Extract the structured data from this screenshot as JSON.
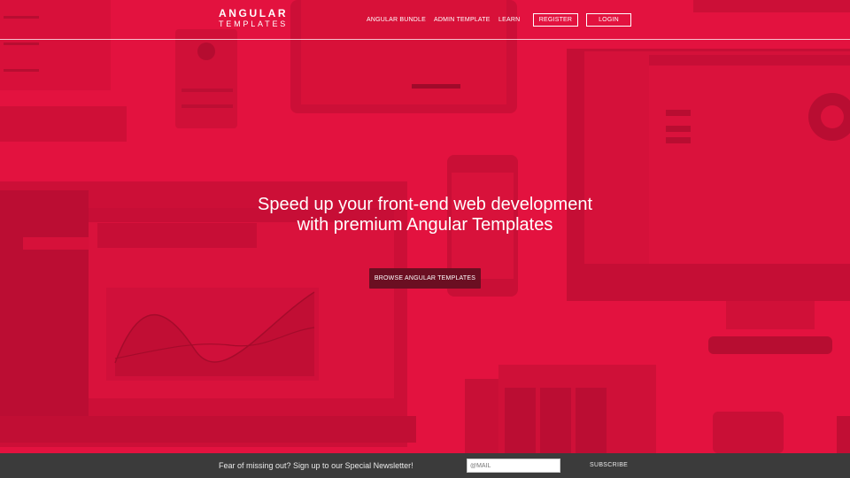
{
  "brand": {
    "line1": "ANGULAR",
    "line2": "TEMPLATES"
  },
  "nav": {
    "bundle": "ANGULAR BUNDLE",
    "admin": "ADMIN TEMPLATE",
    "learn": "LEARN",
    "register": "REGISTER",
    "login": "LOGIN"
  },
  "hero": {
    "title": "Speed up your front-end web development with premium Angular Templates",
    "button": "BROWSE ANGULAR TEMPLATES"
  },
  "newsletter": {
    "message": "Fear of missing out? Sign up to our Special Newsletter!",
    "email_placeholder": "@MAIL",
    "subscribe": "SUBSCRIBE"
  },
  "colors": {
    "hero_overlay": "#e3123f",
    "button_bg": "#6b0f22",
    "footer_bg": "#3b3b3b"
  }
}
